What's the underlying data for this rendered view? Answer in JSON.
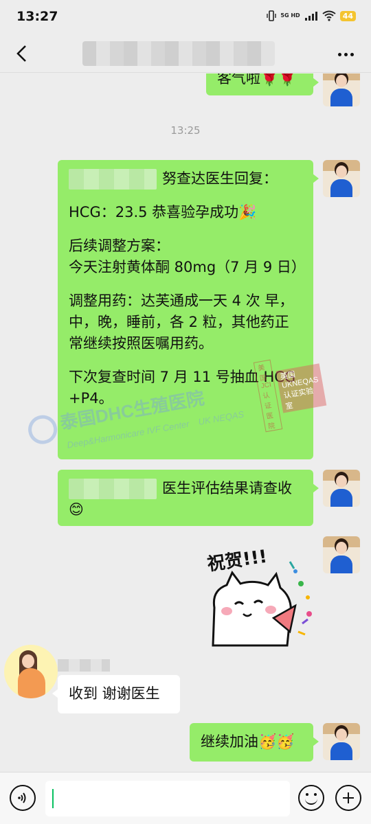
{
  "status_bar": {
    "time": "13:27",
    "network": "5G HD",
    "battery": "44"
  },
  "nav": {
    "back_icon": "back-chevron-icon",
    "more_icon": "more-dots-icon"
  },
  "messages": {
    "m0_text": "客气啦🌹🌹",
    "timestamp": "13:25",
    "m1_head": "努查达医生回复：",
    "m1_line1": "HCG：23.5 恭喜验孕成功🎉",
    "m1_line2": "后续调整方案：\n今天注射黄体酮 80mg（7 月 9 日）",
    "m1_line3": "调整用药：达芙通成一天 4 次 早，中，晚，睡前，各 2 粒，其他药正常继续按照医嘱用药。",
    "m1_line4": "下次复查时间 7 月 11 号抽血 HCG +P4。",
    "m2_text": "医生评估结果请查收😊",
    "m3_sticker_text": "祝贺!!!",
    "m4_text": "收到 谢谢医生",
    "m5_text": "继续加油🥳🥳"
  },
  "watermark": {
    "main": "泰国DHC生殖医院",
    "sub": "Deep&Harmonicare IVF Center",
    "sub2": "UK NEQAS",
    "badge1": "美国JCI认证医院",
    "badge2": "英国UKNEQAS认证实验室"
  },
  "input": {
    "placeholder": ""
  },
  "colors": {
    "bubble_green": "#95ec69",
    "background": "#ededed"
  }
}
